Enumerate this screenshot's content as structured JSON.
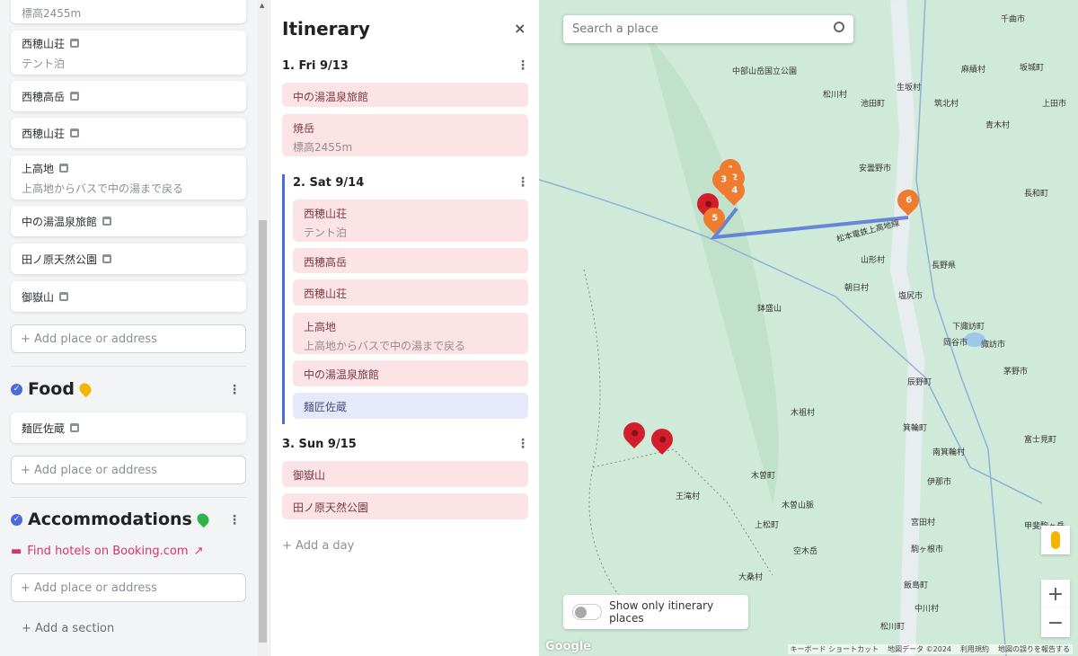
{
  "left": {
    "cards": [
      {
        "title": "",
        "sub": "標高2455m"
      },
      {
        "title": "西穂山荘",
        "sub": "テント泊"
      },
      {
        "title": "西穂高岳",
        "sub": ""
      },
      {
        "title": "西穂山荘",
        "sub": ""
      },
      {
        "title": "上高地",
        "sub": "上高地からバスで中の湯まで戻る"
      },
      {
        "title": "中の湯温泉旅館",
        "sub": ""
      },
      {
        "title": "田ノ原天然公園",
        "sub": ""
      },
      {
        "title": "御嶽山",
        "sub": ""
      }
    ],
    "add_placeholder": "+ Add place or address",
    "food": {
      "title": "Food",
      "items": [
        {
          "title": "麺匠佐蔵"
        }
      ],
      "icon": "pin-yellow-icon",
      "color": "#f4b400"
    },
    "accommodations": {
      "title": "Accommodations",
      "icon": "pin-green-icon",
      "color": "#2fb34a",
      "booking_link": "Find hotels on Booking.com"
    },
    "add_section": "+ Add a section",
    "accent": "#4a6bd8"
  },
  "itinerary": {
    "title": "Itinerary",
    "close": "×",
    "days": [
      {
        "label": "1. Fri 9/13",
        "items": [
          {
            "title": "中の湯温泉旅館",
            "sub": ""
          },
          {
            "title": "焼岳",
            "sub": "標高2455m"
          }
        ]
      },
      {
        "label": "2. Sat 9/14",
        "items": [
          {
            "title": "西穂山荘",
            "sub": "テント泊"
          },
          {
            "title": "西穂高岳",
            "sub": ""
          },
          {
            "title": "西穂山荘",
            "sub": ""
          },
          {
            "title": "上高地",
            "sub": "上高地からバスで中の湯まで戻る"
          },
          {
            "title": "中の湯温泉旅館",
            "sub": ""
          },
          {
            "title": "麺匠佐蔵",
            "sub": ""
          }
        ]
      },
      {
        "label": "3. Sun 9/15",
        "items": [
          {
            "title": "御嶽山",
            "sub": ""
          },
          {
            "title": "田ノ原天然公園",
            "sub": ""
          }
        ]
      }
    ],
    "add_day": "+ Add a day"
  },
  "map": {
    "search_placeholder": "Search a place",
    "toggle_label": "Show only itinerary places",
    "toggle_on": false,
    "zoom_in": "+",
    "zoom_out": "−",
    "google": "Google",
    "attribution": [
      "キーボード ショートカット",
      "地図データ ©2024",
      "利用規約",
      "地図の誤りを報告する"
    ],
    "labels": [
      "中部山岳国立公園",
      "松川村",
      "池田町",
      "生坂村",
      "筑北村",
      "麻績村",
      "坂城町",
      "上田市",
      "青木村",
      "安曇野市",
      "長和町",
      "山形村",
      "長野県",
      "朝日村",
      "塩尻市",
      "鉢盛山",
      "下諏訪町",
      "岡谷市",
      "諏訪市",
      "茅野市",
      "辰野町",
      "木祖村",
      "箕輪町",
      "南箕輪村",
      "木曽町",
      "伊那市",
      "王滝村",
      "木曽山脈",
      "上松町",
      "宮田村",
      "空木岳",
      "駒ヶ根市",
      "大桑村",
      "飯島町",
      "中川村",
      "松川町",
      "甲斐駒ヶ岳",
      "富士見町",
      "千曲市",
      "松本電鉄上高地線"
    ],
    "pins": [
      {
        "num": "1"
      },
      {
        "num": "2"
      },
      {
        "num": "3"
      },
      {
        "num": "4"
      },
      {
        "num": "5"
      },
      {
        "num": "6"
      }
    ],
    "pin_color": "#ef7b2e",
    "route_color": "#4a6bd8"
  }
}
